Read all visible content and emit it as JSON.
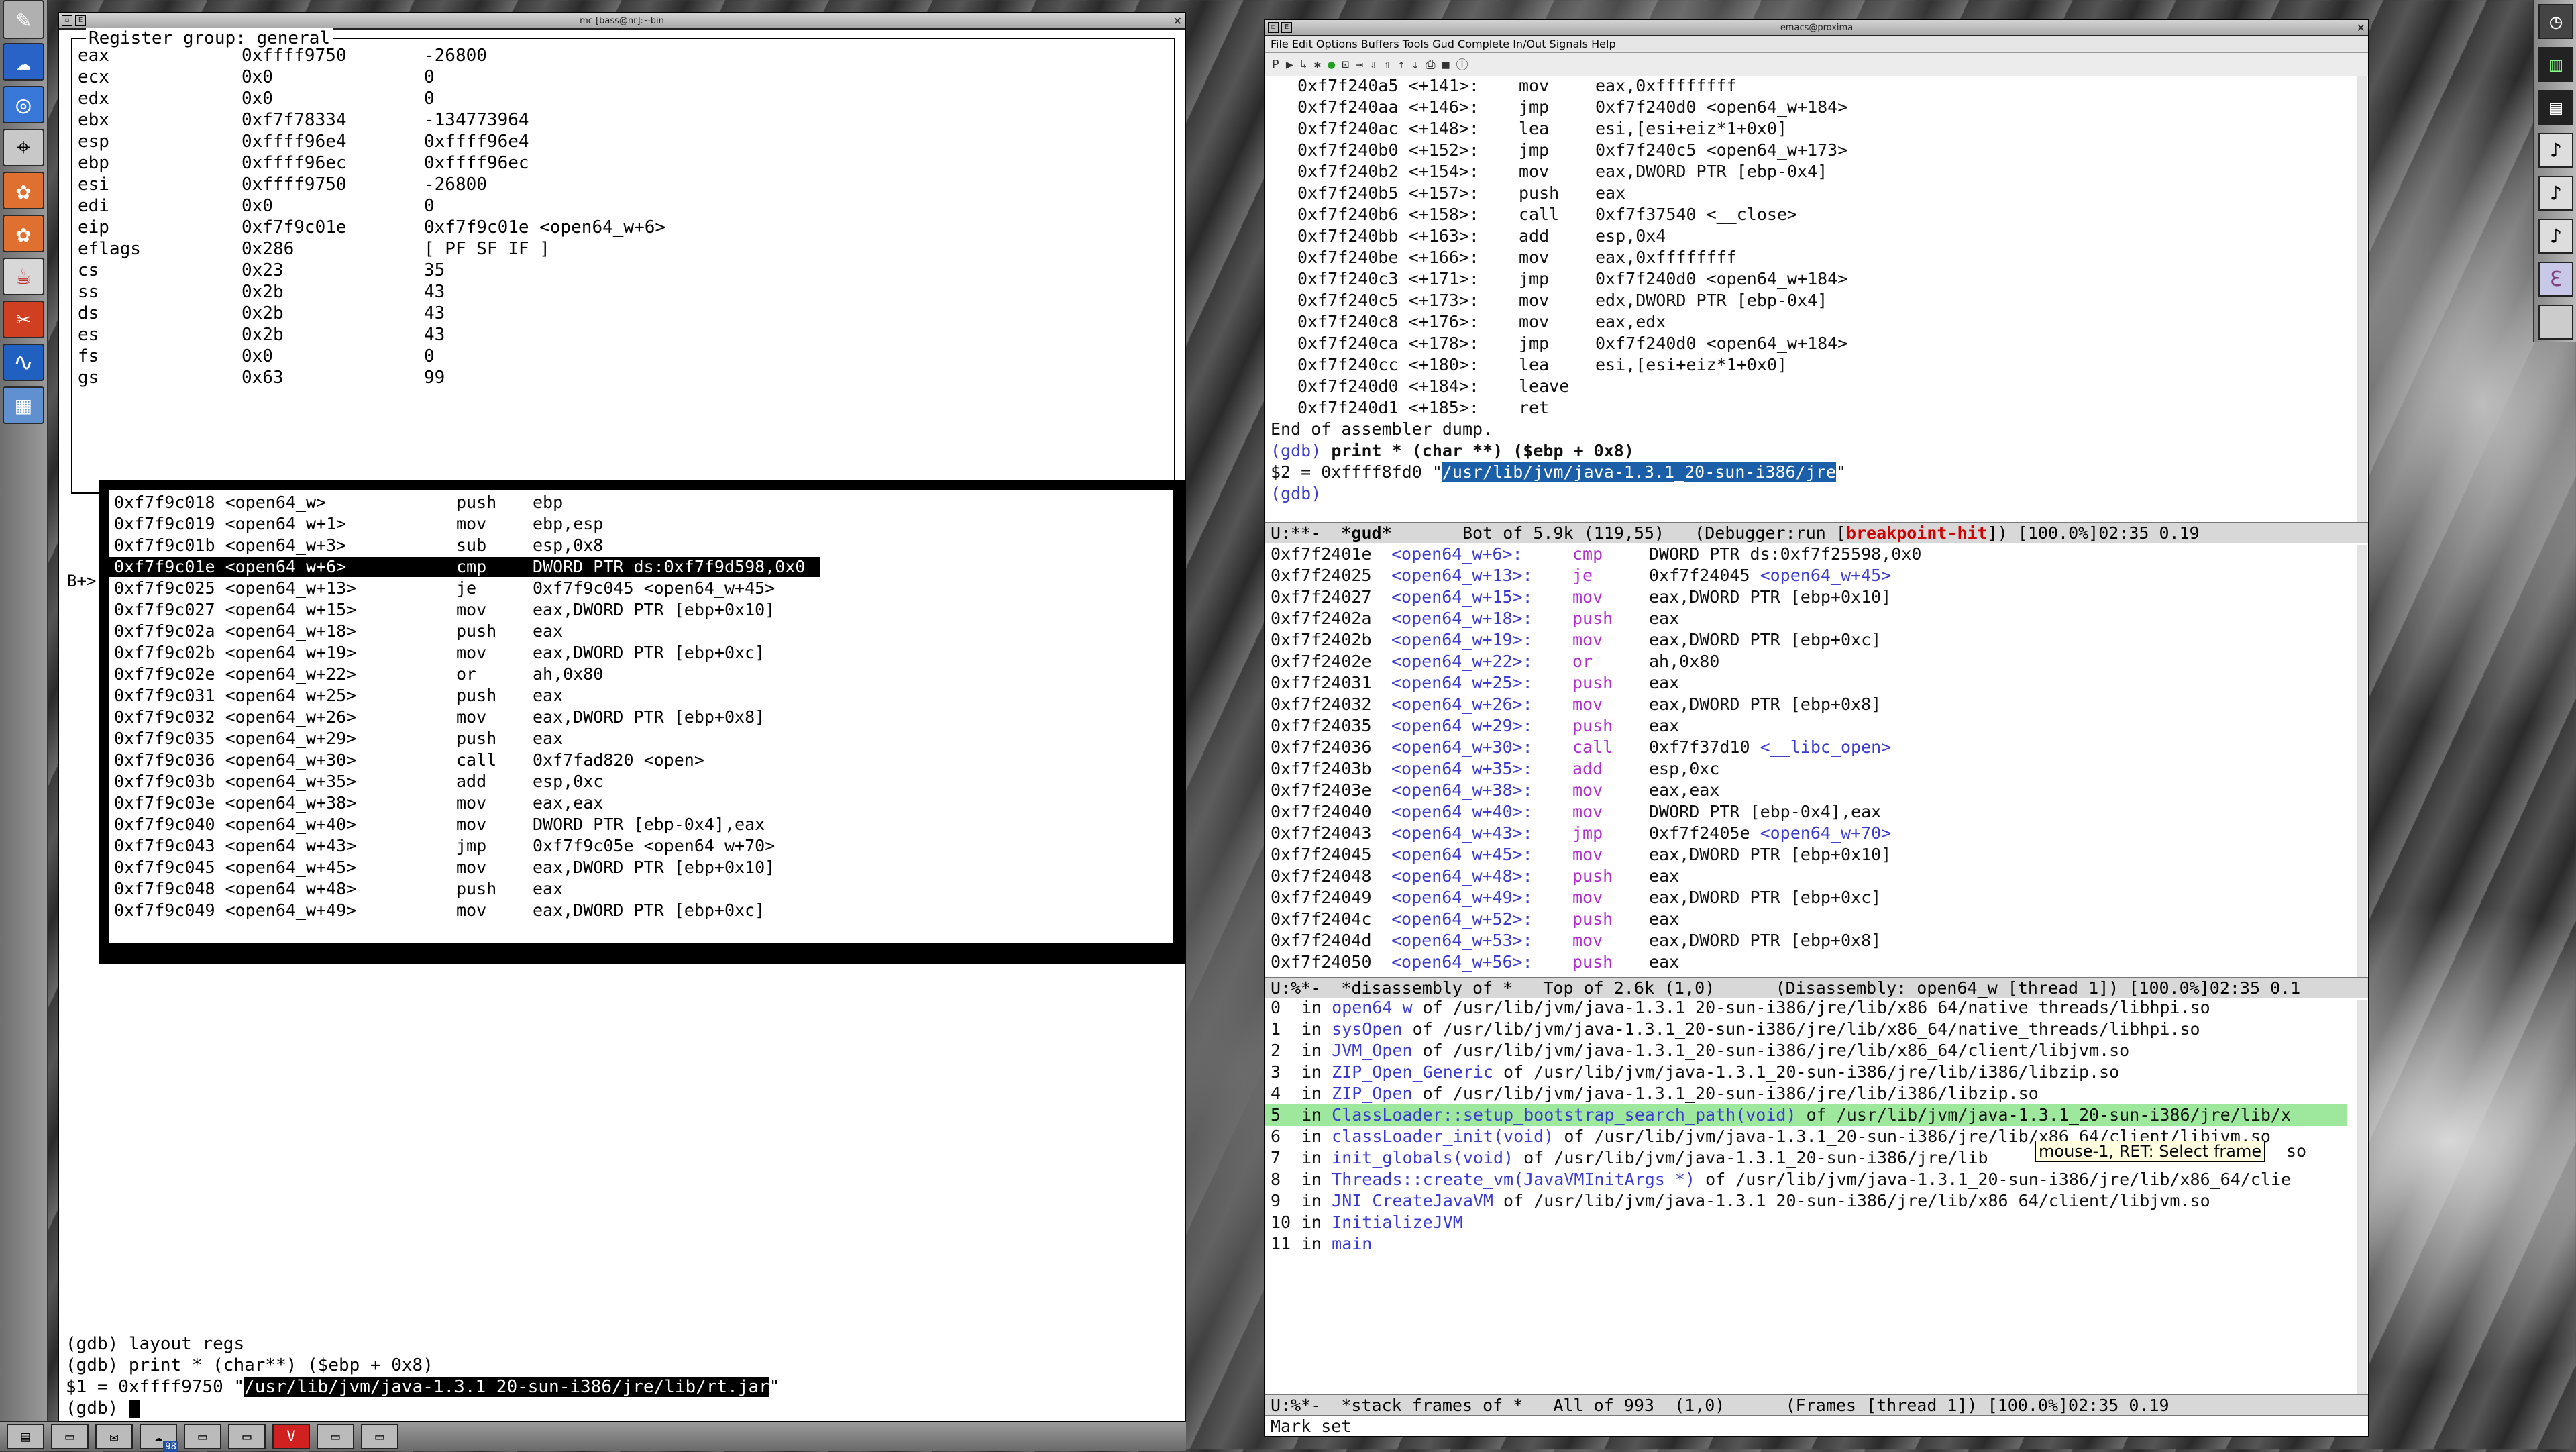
{
  "xterm": {
    "title": "mc [bass@nr]:~bin",
    "register_group_title": "Register group: general",
    "registers": [
      {
        "name": "eax",
        "hex": "0xffff9750",
        "val": "-26800"
      },
      {
        "name": "ecx",
        "hex": "0x0",
        "val": "0"
      },
      {
        "name": "edx",
        "hex": "0x0",
        "val": "0"
      },
      {
        "name": "ebx",
        "hex": "0xf7f78334",
        "val": "-134773964"
      },
      {
        "name": "esp",
        "hex": "0xffff96e4",
        "val": "0xffff96e4"
      },
      {
        "name": "ebp",
        "hex": "0xffff96ec",
        "val": "0xffff96ec"
      },
      {
        "name": "esi",
        "hex": "0xffff9750",
        "val": "-26800"
      },
      {
        "name": "edi",
        "hex": "0x0",
        "val": "0"
      },
      {
        "name": "eip",
        "hex": "0xf7f9c01e",
        "val": "0xf7f9c01e <open64_w+6>"
      },
      {
        "name": "eflags",
        "hex": "0x286",
        "val": "[ PF SF IF ]"
      },
      {
        "name": "cs",
        "hex": "0x23",
        "val": "35"
      },
      {
        "name": "ss",
        "hex": "0x2b",
        "val": "43"
      },
      {
        "name": "ds",
        "hex": "0x2b",
        "val": "43"
      },
      {
        "name": "es",
        "hex": "0x2b",
        "val": "43"
      },
      {
        "name": "fs",
        "hex": "0x0",
        "val": "0"
      },
      {
        "name": "gs",
        "hex": "0x63",
        "val": "99"
      }
    ],
    "bp_marker": "B+>",
    "asm": [
      {
        "addr": "0xf7f9c018 <open64_w>",
        "mn": "push",
        "op": "ebp"
      },
      {
        "addr": "0xf7f9c019 <open64_w+1>",
        "mn": "mov",
        "op": "ebp,esp"
      },
      {
        "addr": "0xf7f9c01b <open64_w+3>",
        "mn": "sub",
        "op": "esp,0x8"
      },
      {
        "addr": "0xf7f9c01e <open64_w+6>",
        "mn": "cmp",
        "op": "DWORD PTR ds:0xf7f9d598,0x0",
        "current": true
      },
      {
        "addr": "0xf7f9c025 <open64_w+13>",
        "mn": "je",
        "op": "0xf7f9c045 <open64_w+45>"
      },
      {
        "addr": "0xf7f9c027 <open64_w+15>",
        "mn": "mov",
        "op": "eax,DWORD PTR [ebp+0x10]"
      },
      {
        "addr": "0xf7f9c02a <open64_w+18>",
        "mn": "push",
        "op": "eax"
      },
      {
        "addr": "0xf7f9c02b <open64_w+19>",
        "mn": "mov",
        "op": "eax,DWORD PTR [ebp+0xc]"
      },
      {
        "addr": "0xf7f9c02e <open64_w+22>",
        "mn": "or",
        "op": "ah,0x80"
      },
      {
        "addr": "0xf7f9c031 <open64_w+25>",
        "mn": "push",
        "op": "eax"
      },
      {
        "addr": "0xf7f9c032 <open64_w+26>",
        "mn": "mov",
        "op": "eax,DWORD PTR [ebp+0x8]"
      },
      {
        "addr": "0xf7f9c035 <open64_w+29>",
        "mn": "push",
        "op": "eax"
      },
      {
        "addr": "0xf7f9c036 <open64_w+30>",
        "mn": "call",
        "op": "0xf7fad820 <open>"
      },
      {
        "addr": "0xf7f9c03b <open64_w+35>",
        "mn": "add",
        "op": "esp,0xc"
      },
      {
        "addr": "0xf7f9c03e <open64_w+38>",
        "mn": "mov",
        "op": "eax,eax"
      },
      {
        "addr": "0xf7f9c040 <open64_w+40>",
        "mn": "mov",
        "op": "DWORD PTR [ebp-0x4],eax"
      },
      {
        "addr": "0xf7f9c043 <open64_w+43>",
        "mn": "jmp",
        "op": "0xf7f9c05e <open64_w+70>"
      },
      {
        "addr": "0xf7f9c045 <open64_w+45>",
        "mn": "mov",
        "op": "eax,DWORD PTR [ebp+0x10]"
      },
      {
        "addr": "0xf7f9c048 <open64_w+48>",
        "mn": "push",
        "op": "eax"
      },
      {
        "addr": "0xf7f9c049 <open64_w+49>",
        "mn": "mov",
        "op": "eax,DWORD PTR [ebp+0xc]"
      }
    ],
    "cmd1": "(gdb) layout regs",
    "cmd2": "(gdb) print * (char**) ($ebp + 0x8)",
    "cmd3_prefix": "$1 = 0xffff9750 \"",
    "cmd3_path": "/usr/lib/jvm/java-1.3.1_20-sun-i386/jre/lib/rt.jar",
    "cmd3_suffix": "\"",
    "prompt": "(gdb) "
  },
  "emacs": {
    "title": "emacs@proxima",
    "menu": "File Edit Options Buffers Tools Gud Complete In/Out Signals Help",
    "gud_lines": [
      {
        "addr": "0xf7f240a5 <+141>:",
        "mn": "mov",
        "op": "eax,0xffffffff"
      },
      {
        "addr": "0xf7f240aa <+146>:",
        "mn": "jmp",
        "op": "0xf7f240d0 <open64_w+184>"
      },
      {
        "addr": "0xf7f240ac <+148>:",
        "mn": "lea",
        "op": "esi,[esi+eiz*1+0x0]"
      },
      {
        "addr": "0xf7f240b0 <+152>:",
        "mn": "jmp",
        "op": "0xf7f240c5 <open64_w+173>"
      },
      {
        "addr": "0xf7f240b2 <+154>:",
        "mn": "mov",
        "op": "eax,DWORD PTR [ebp-0x4]"
      },
      {
        "addr": "0xf7f240b5 <+157>:",
        "mn": "push",
        "op": "eax"
      },
      {
        "addr": "0xf7f240b6 <+158>:",
        "mn": "call",
        "op": "0xf7f37540 <__close>"
      },
      {
        "addr": "0xf7f240bb <+163>:",
        "mn": "add",
        "op": "esp,0x4"
      },
      {
        "addr": "0xf7f240be <+166>:",
        "mn": "mov",
        "op": "eax,0xffffffff"
      },
      {
        "addr": "0xf7f240c3 <+171>:",
        "mn": "jmp",
        "op": "0xf7f240d0 <open64_w+184>"
      },
      {
        "addr": "0xf7f240c5 <+173>:",
        "mn": "mov",
        "op": "edx,DWORD PTR [ebp-0x4]"
      },
      {
        "addr": "0xf7f240c8 <+176>:",
        "mn": "mov",
        "op": "eax,edx"
      },
      {
        "addr": "0xf7f240ca <+178>:",
        "mn": "jmp",
        "op": "0xf7f240d0 <open64_w+184>"
      },
      {
        "addr": "0xf7f240cc <+180>:",
        "mn": "lea",
        "op": "esi,[esi+eiz*1+0x0]"
      },
      {
        "addr": "0xf7f240d0 <+184>:",
        "mn": "leave",
        "op": ""
      },
      {
        "addr": "0xf7f240d1 <+185>:",
        "mn": "ret",
        "op": ""
      }
    ],
    "gud_end": "End of assembler dump.",
    "gud_cmd_prompt": "(gdb)",
    "gud_cmd": " print * (char **) ($ebp + 0x8)",
    "gud_result_prefix": "$2 = 0xffff8fd0 \"",
    "gud_result_path": "/usr/lib/jvm/java-1.3.1_20-sun-i386/jre",
    "gud_result_suffix": "\"",
    "gud_prompt2": "(gdb)",
    "modeline1_a": "U:**-  ",
    "modeline1_buf": "*gud*",
    "modeline1_b": "       Bot of 5.9k (119,55)   (Debugger:run [",
    "modeline1_bp": "breakpoint-hit",
    "modeline1_c": "]) [100.0%]02:35 0.19",
    "dis_lines": [
      {
        "addr": "0xf7f2401e",
        "fn": "<open64_w+6>:",
        "mn": "cmp",
        "op": "DWORD PTR ds:0xf7f25598,0x0"
      },
      {
        "addr": "0xf7f24025",
        "fn": "<open64_w+13>:",
        "mn": "je",
        "op": "0xf7f24045 ",
        "op_link": "<open64_w+45>"
      },
      {
        "addr": "0xf7f24027",
        "fn": "<open64_w+15>:",
        "mn": "mov",
        "op": "eax,DWORD PTR [ebp+0x10]"
      },
      {
        "addr": "0xf7f2402a",
        "fn": "<open64_w+18>:",
        "mn": "push",
        "op": "eax"
      },
      {
        "addr": "0xf7f2402b",
        "fn": "<open64_w+19>:",
        "mn": "mov",
        "op": "eax,DWORD PTR [ebp+0xc]"
      },
      {
        "addr": "0xf7f2402e",
        "fn": "<open64_w+22>:",
        "mn": "or",
        "op": "ah,0x80"
      },
      {
        "addr": "0xf7f24031",
        "fn": "<open64_w+25>:",
        "mn": "push",
        "op": "eax"
      },
      {
        "addr": "0xf7f24032",
        "fn": "<open64_w+26>:",
        "mn": "mov",
        "op": "eax,DWORD PTR [ebp+0x8]"
      },
      {
        "addr": "0xf7f24035",
        "fn": "<open64_w+29>:",
        "mn": "push",
        "op": "eax"
      },
      {
        "addr": "0xf7f24036",
        "fn": "<open64_w+30>:",
        "mn": "call",
        "op": "0xf7f37d10 ",
        "op_link": "<__libc_open>"
      },
      {
        "addr": "0xf7f2403b",
        "fn": "<open64_w+35>:",
        "mn": "add",
        "op": "esp,0xc"
      },
      {
        "addr": "0xf7f2403e",
        "fn": "<open64_w+38>:",
        "mn": "mov",
        "op": "eax,eax"
      },
      {
        "addr": "0xf7f24040",
        "fn": "<open64_w+40>:",
        "mn": "mov",
        "op": "DWORD PTR [ebp-0x4],eax"
      },
      {
        "addr": "0xf7f24043",
        "fn": "<open64_w+43>:",
        "mn": "jmp",
        "op": "0xf7f2405e ",
        "op_link": "<open64_w+70>"
      },
      {
        "addr": "0xf7f24045",
        "fn": "<open64_w+45>:",
        "mn": "mov",
        "op": "eax,DWORD PTR [ebp+0x10]"
      },
      {
        "addr": "0xf7f24048",
        "fn": "<open64_w+48>:",
        "mn": "push",
        "op": "eax"
      },
      {
        "addr": "0xf7f24049",
        "fn": "<open64_w+49>:",
        "mn": "mov",
        "op": "eax,DWORD PTR [ebp+0xc]"
      },
      {
        "addr": "0xf7f2404c",
        "fn": "<open64_w+52>:",
        "mn": "push",
        "op": "eax"
      },
      {
        "addr": "0xf7f2404d",
        "fn": "<open64_w+53>:",
        "mn": "mov",
        "op": "eax,DWORD PTR [ebp+0x8]"
      },
      {
        "addr": "0xf7f24050",
        "fn": "<open64_w+56>:",
        "mn": "push",
        "op": "eax"
      }
    ],
    "modeline2": "U:%*-  *disassembly of *   Top of 2.6k (1,0)      (Disassembly: open64_w [thread 1]) [100.0%]02:35 0.1",
    "frames": [
      {
        "n": "0",
        "fn": "open64_w",
        "rest": " of /usr/lib/jvm/java-1.3.1_20-sun-i386/jre/lib/x86_64/native_threads/libhpi.so"
      },
      {
        "n": "1",
        "fn": "sysOpen",
        "rest": " of /usr/lib/jvm/java-1.3.1_20-sun-i386/jre/lib/x86_64/native_threads/libhpi.so"
      },
      {
        "n": "2",
        "fn": "JVM_Open",
        "rest": " of /usr/lib/jvm/java-1.3.1_20-sun-i386/jre/lib/x86_64/client/libjvm.so"
      },
      {
        "n": "3",
        "fn": "ZIP_Open_Generic",
        "rest": " of /usr/lib/jvm/java-1.3.1_20-sun-i386/jre/lib/i386/libzip.so"
      },
      {
        "n": "4",
        "fn": "ZIP_Open",
        "rest": " of /usr/lib/jvm/java-1.3.1_20-sun-i386/jre/lib/i386/libzip.so"
      },
      {
        "n": "5",
        "fn": "ClassLoader::setup_bootstrap_search_path(void)",
        "rest": " of /usr/lib/jvm/java-1.3.1_20-sun-i386/jre/lib/x",
        "hl": true
      },
      {
        "n": "6",
        "fn": "classLoader_init(void)",
        "rest": " of /usr/lib/jvm/java-1.3.1_20-sun-i386/jre/lib/x86_64/client/libjvm.so"
      },
      {
        "n": "7",
        "fn": "init_globals(void)",
        "rest": " of /usr/lib/jvm/java-1.3.1_20-sun-i386/jre/lib"
      },
      {
        "n": "8",
        "fn": "Threads::create_vm(JavaVMInitArgs *)",
        "rest": " of /usr/lib/jvm/java-1.3.1_20-sun-i386/jre/lib/x86_64/clie"
      },
      {
        "n": "9",
        "fn": "JNI_CreateJavaVM",
        "rest": " of /usr/lib/jvm/java-1.3.1_20-sun-i386/jre/lib/x86_64/client/libjvm.so"
      },
      {
        "n": "10",
        "fn": "InitializeJVM",
        "rest": ""
      },
      {
        "n": "11",
        "fn": "main",
        "rest": ""
      }
    ],
    "tooltip": "mouse-1, RET: Select frame",
    "tooltip_tail": "so",
    "modeline3": "U:%*-  *stack frames of *   All of 993  (1,0)      (Frames [thread 1]) [100.0%]02:35 0.19",
    "echo": "Mark set"
  },
  "taskbar": {
    "badge": "98"
  }
}
